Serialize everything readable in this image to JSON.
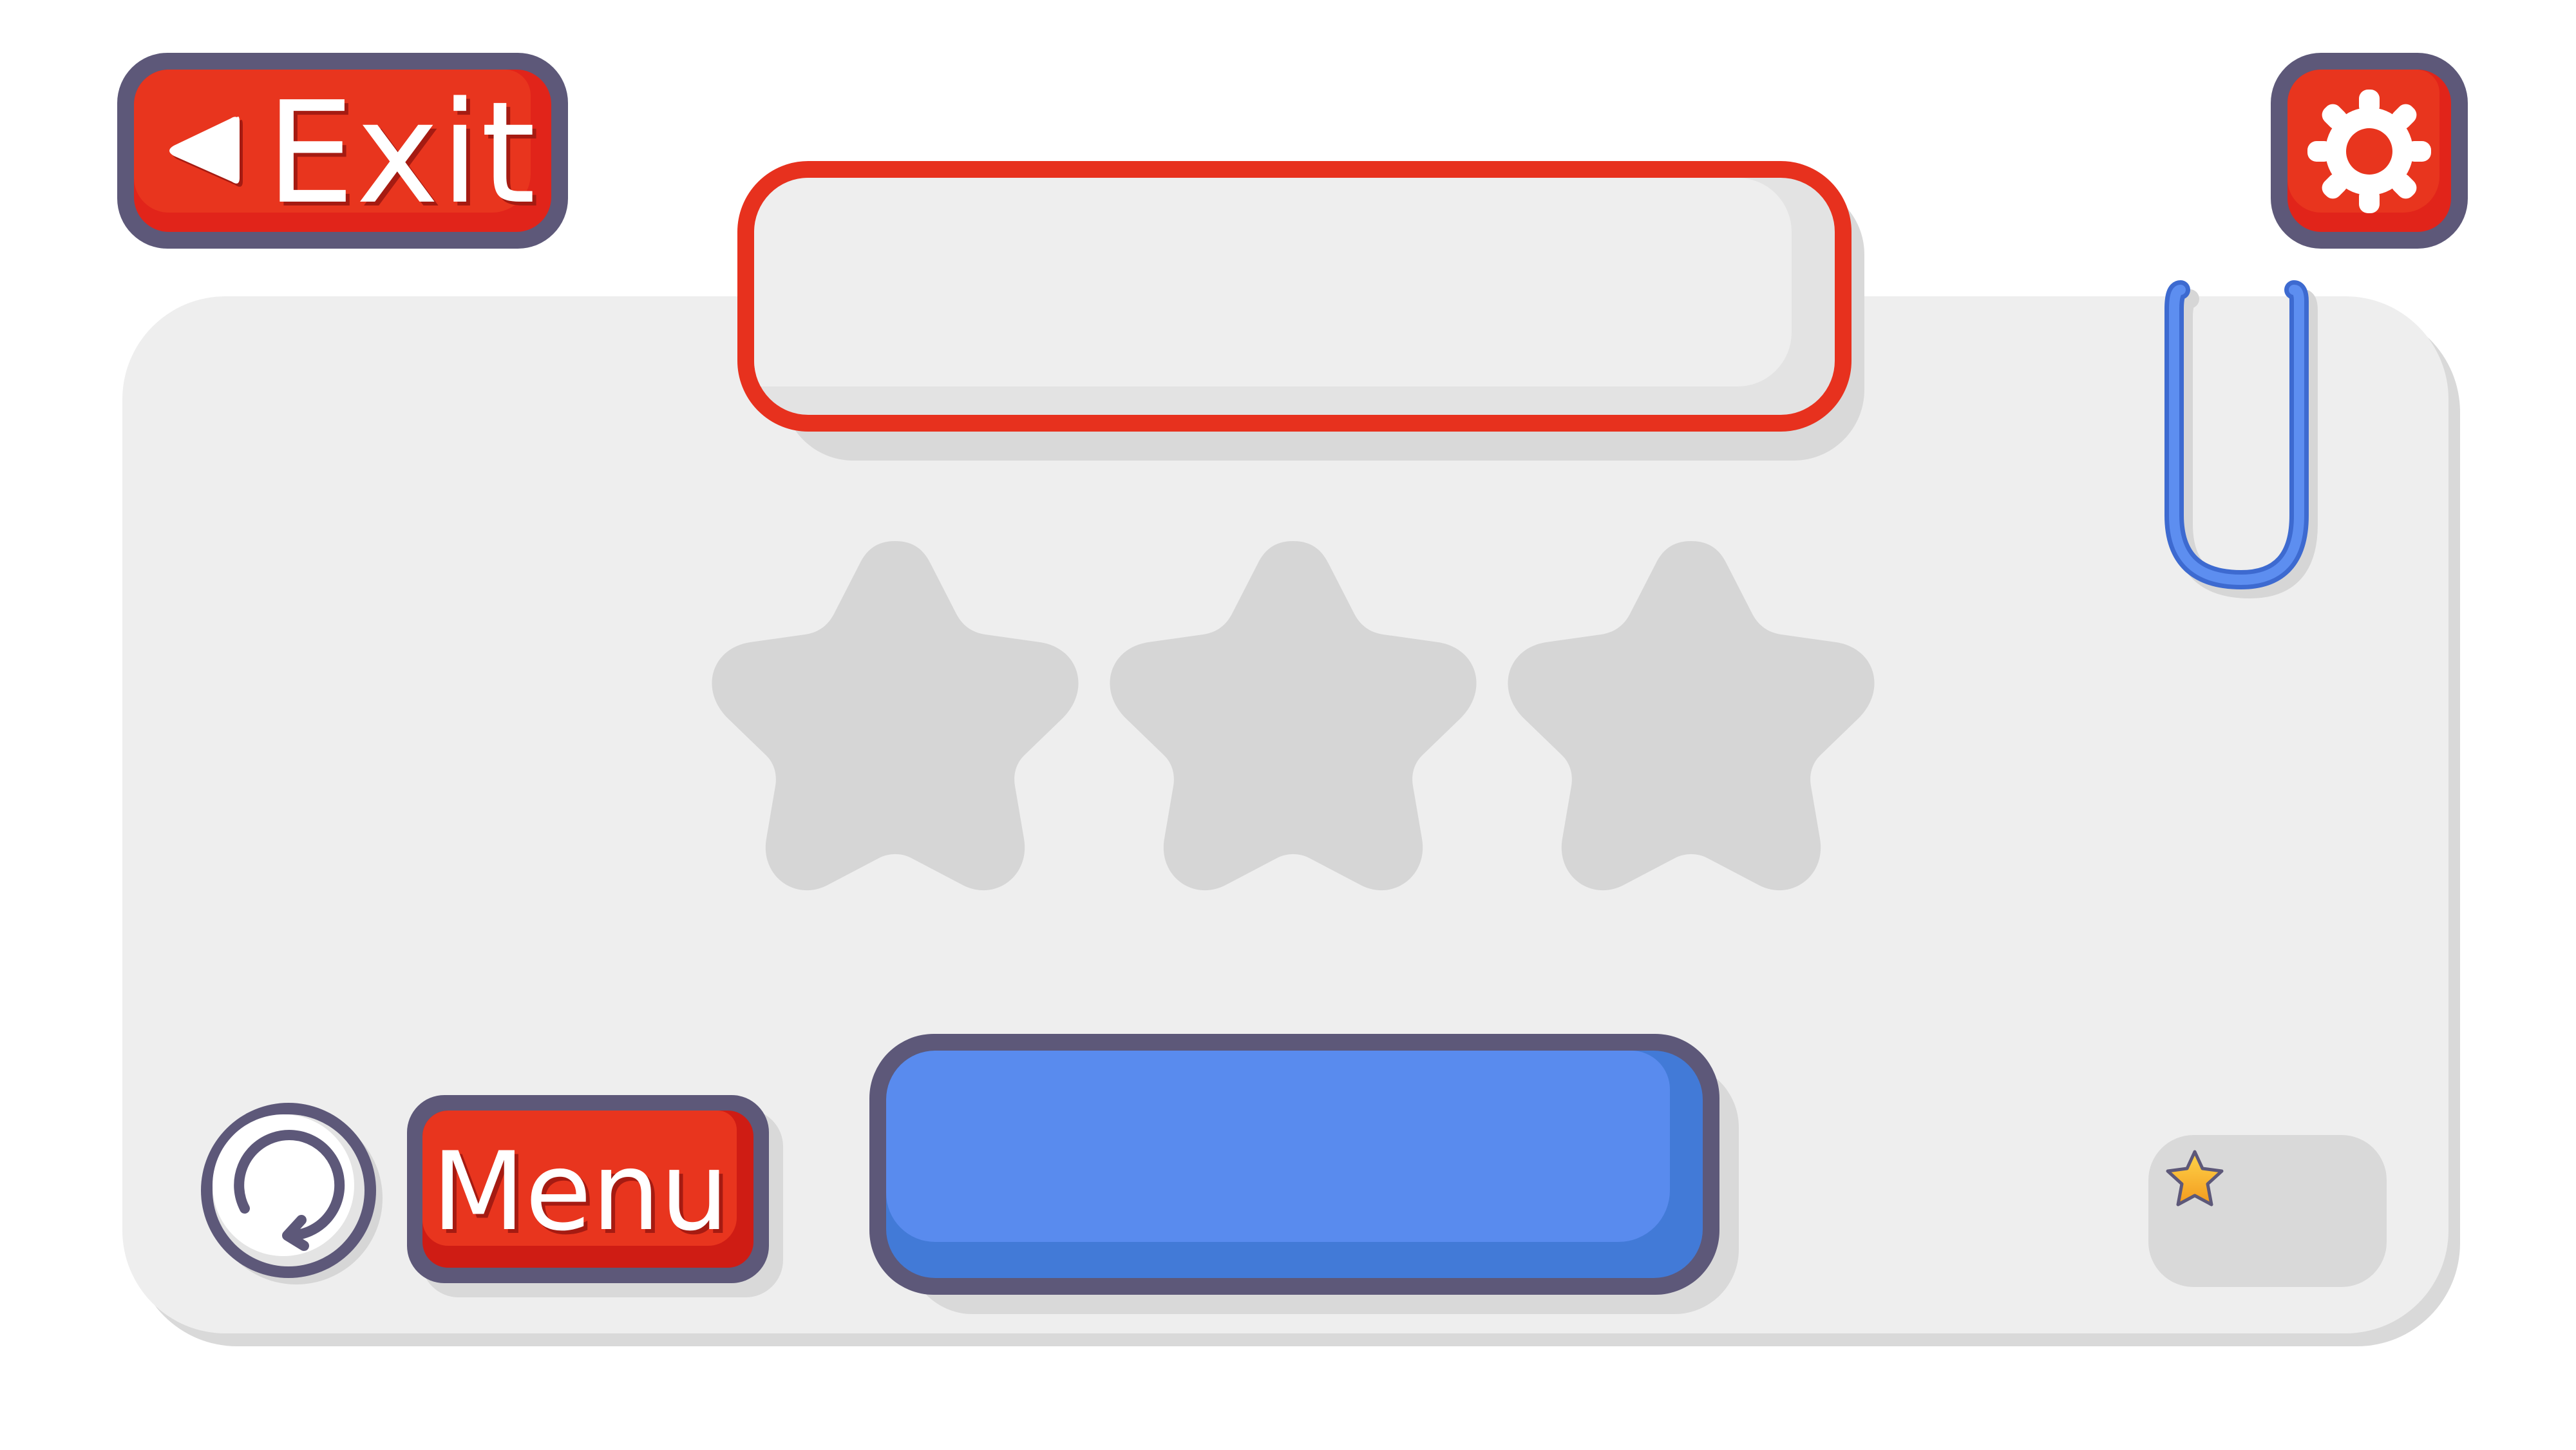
{
  "header": {
    "exit_label": "Exit"
  },
  "title_banner": {
    "text": ""
  },
  "rating": {
    "stars_earned": 0,
    "stars_total": 3
  },
  "footer": {
    "menu_label": "Menu",
    "action_label": "",
    "star_count": ""
  },
  "icons": {
    "exit": "back-triangle-icon",
    "settings": "gear-icon",
    "restart": "restart-icon",
    "clip": "paperclip-icon",
    "rating_star": "star-icon",
    "counter_star": "gold-star-icon"
  },
  "colors": {
    "button_red": "#e8351e",
    "button_border": "#5d5879",
    "action_blue": "#598bee",
    "panel": "#eeeeee",
    "star_empty": "#d6d6d6",
    "clip_blue": "#5584e8",
    "gold": "#f3b22b"
  }
}
